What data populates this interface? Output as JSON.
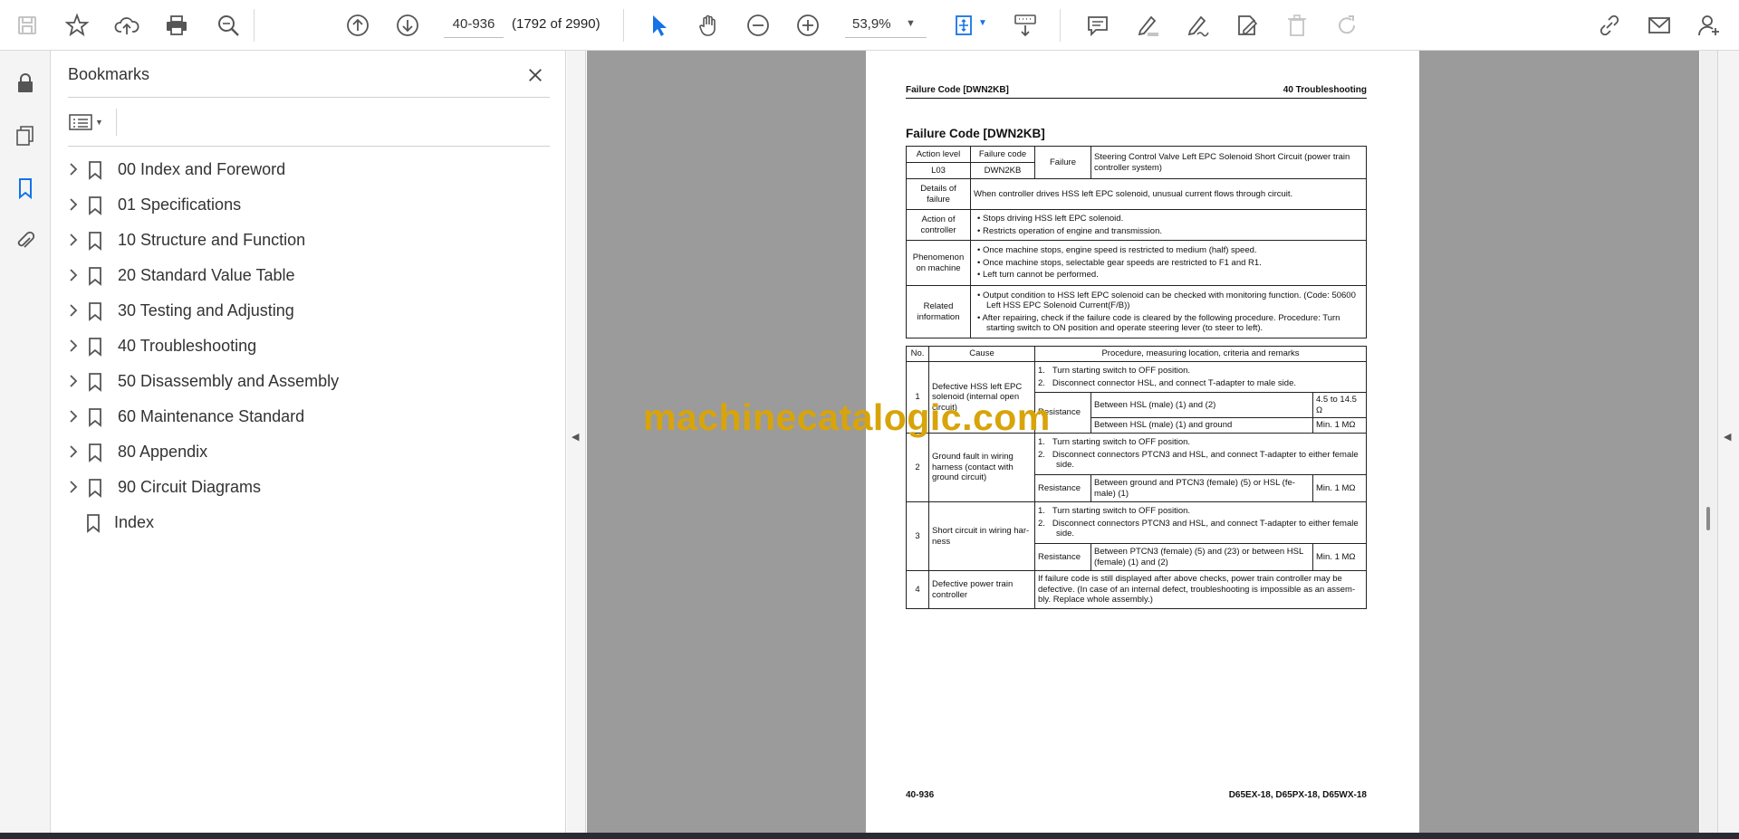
{
  "toolbar": {
    "page_number": "40-936",
    "page_count": "(1792 of 2990)",
    "zoom": "53,9%"
  },
  "bookmarks_panel": {
    "title": "Bookmarks",
    "items": [
      {
        "label": "00 Index and Foreword"
      },
      {
        "label": "01 Specifications"
      },
      {
        "label": "10 Structure and Function"
      },
      {
        "label": "20 Standard Value Table"
      },
      {
        "label": "30 Testing and Adjusting"
      },
      {
        "label": "40 Troubleshooting"
      },
      {
        "label": "50 Disassembly and Assembly"
      },
      {
        "label": "60 Maintenance Standard"
      },
      {
        "label": "80 Appendix"
      },
      {
        "label": "90 Circuit Diagrams"
      },
      {
        "label": "Index"
      }
    ]
  },
  "document": {
    "header_left": "Failure Code [DWN2KB]",
    "header_right": "40 Troubleshooting",
    "title": "Failure Code [DWN2KB]",
    "info": {
      "action_level_label": "Action level",
      "failure_code_label": "Failure code",
      "failure_label": "Failure",
      "action_level": "L03",
      "failure_code": "DWN2KB",
      "failure": "Steering Control Valve Left EPC Solenoid Short Circuit (power train controller system)",
      "details_label": "Details of failure",
      "details": "When controller drives HSS left EPC solenoid, unusual current flows through circuit.",
      "action_controller_label": "Action of controller",
      "action_controller": [
        "Stops driving HSS left EPC solenoid.",
        "Restricts operation of engine and transmission."
      ],
      "phenomenon_label": "Phenomenon on machine",
      "phenomenon": [
        "Once machine stops, engine speed is restricted to medium (half) speed.",
        "Once machine stops, selectable gear speeds are restricted to F1 and R1.",
        "Left turn cannot be performed."
      ],
      "related_label": "Related information",
      "related": [
        "Output condition to HSS left EPC solenoid can be checked with monitoring function. (Code: 50600 Left HSS EPC Solenoid Current(F/B))",
        "After repairing, check if the failure code is cleared by the following procedure. Procedure: Turn starting switch to ON position and operate steering lever (to steer to left)."
      ]
    },
    "causes_header": {
      "no": "No.",
      "cause": "Cause",
      "procedure": "Procedure, measuring location, criteria and remarks"
    },
    "causes": [
      {
        "no": "1",
        "cause": "Defective HSS left EPC solenoid (internal open circuit)",
        "steps": [
          "Turn starting switch to OFF position.",
          "Disconnect connector HSL, and connect T-adapter to male side."
        ],
        "measure_label": "Resistance",
        "rows": [
          {
            "location": "Between HSL (male) (1) and (2)",
            "value": "4.5 to 14.5 Ω"
          },
          {
            "location": "Between HSL (male) (1) and ground",
            "value": "Min. 1 MΩ"
          }
        ]
      },
      {
        "no": "2",
        "cause": "Ground fault in wiring harness (contact with ground circuit)",
        "steps": [
          "Turn starting switch to OFF position.",
          "Disconnect connectors PTCN3 and HSL, and connect T-adapter to either female side."
        ],
        "measure_label": "Resistance",
        "rows": [
          {
            "location": "Between ground and PTCN3 (female) (5) or HSL (fe-male) (1)",
            "value": "Min. 1 MΩ"
          }
        ]
      },
      {
        "no": "3",
        "cause": "Short circuit in wiring har-ness",
        "steps": [
          "Turn starting switch to OFF position.",
          "Disconnect connectors PTCN3 and HSL, and connect T-adapter to either female side."
        ],
        "measure_label": "Resistance",
        "rows": [
          {
            "location": "Between PTCN3 (female) (5) and (23) or between HSL (female) (1) and (2)",
            "value": "Min. 1 MΩ"
          }
        ]
      },
      {
        "no": "4",
        "cause": "Defective power train controller",
        "note": "If failure code is still displayed after above checks, power train controller may be defective. (In case of an internal defect, troubleshooting is impossible as an assem-bly. Replace whole assembly.)"
      }
    ],
    "footer_left": "40-936",
    "footer_right": "D65EX-18, D65PX-18, D65WX-18",
    "watermark": "machinecatalogic.com"
  },
  "colors": {
    "accent": "#1473e6",
    "watermark": "#d8a40a",
    "viewer_bg": "#9b9b9b"
  }
}
